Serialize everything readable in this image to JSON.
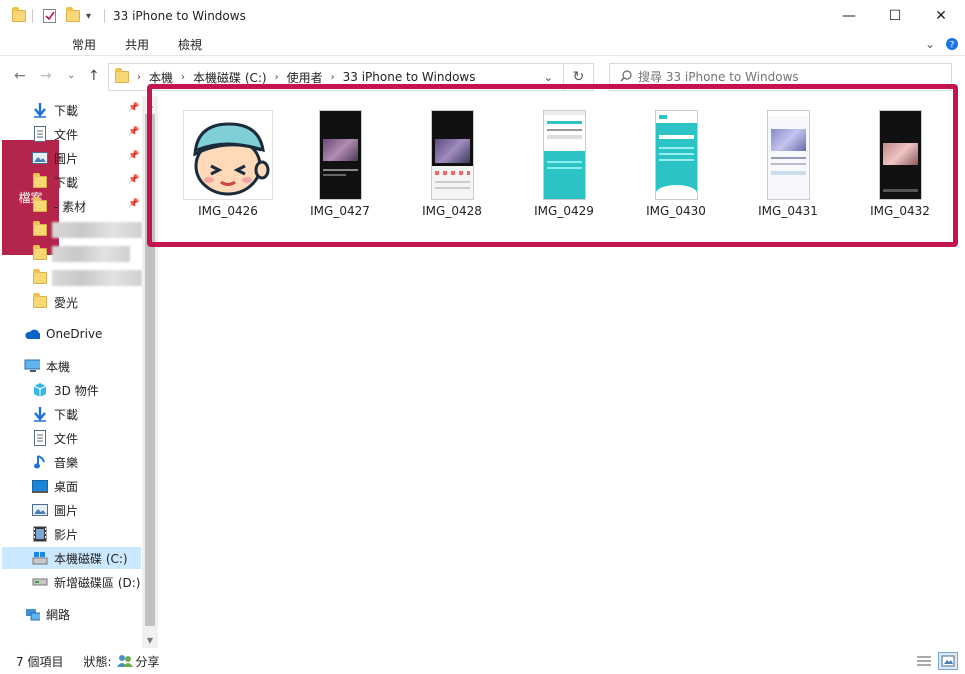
{
  "window": {
    "title": "33 iPhone to Windows",
    "minimize_glyph": "—",
    "maximize_glyph": "☐",
    "close_glyph": "✕"
  },
  "ribbon": {
    "tabs": [
      "檔案",
      "常用",
      "共用",
      "檢視"
    ],
    "collapse_glyph": "⌄",
    "help_glyph": "?"
  },
  "address": {
    "back_glyph": "←",
    "forward_glyph": "→",
    "recent_glyph": "⌄",
    "up_glyph": "↑",
    "breadcrumbs": [
      "本機",
      "本機磁碟 (C:)",
      "使用者",
      "33 iPhone to Windows"
    ],
    "separator": "›",
    "dropdown_glyph": "⌄",
    "refresh_glyph": "↻",
    "search_placeholder": "搜尋 33 iPhone to Windows"
  },
  "nav": {
    "quick_access": [
      {
        "label": "下載",
        "icon": "download-icon",
        "pinned": true
      },
      {
        "label": "文件",
        "icon": "document-icon",
        "pinned": true
      },
      {
        "label": "圖片",
        "icon": "pictures-icon",
        "pinned": true
      },
      {
        "label": "下載",
        "icon": "folder-icon",
        "pinned": true
      },
      {
        "label": "- 素材",
        "icon": "folder-icon",
        "pinned": true
      },
      {
        "label": "",
        "icon": "folder-icon",
        "pinned": false
      },
      {
        "label": "",
        "icon": "folder-icon",
        "pinned": false
      },
      {
        "label": "",
        "icon": "folder-icon",
        "pinned": false
      },
      {
        "label": "愛光",
        "icon": "folder-icon",
        "pinned": false
      }
    ],
    "pin_glyph": "📌",
    "onedrive": "OneDrive",
    "this_pc": "本機",
    "pc_items": [
      {
        "label": "3D 物件",
        "icon": "3d-objects-icon"
      },
      {
        "label": "下載",
        "icon": "download-icon"
      },
      {
        "label": "文件",
        "icon": "document-icon"
      },
      {
        "label": "音樂",
        "icon": "music-icon"
      },
      {
        "label": "桌面",
        "icon": "desktop-icon"
      },
      {
        "label": "圖片",
        "icon": "pictures-icon"
      },
      {
        "label": "影片",
        "icon": "videos-icon"
      },
      {
        "label": "本機磁碟 (C:)",
        "icon": "drive-c-icon",
        "selected": true
      },
      {
        "label": "新增磁碟區 (D:)",
        "icon": "drive-d-icon"
      }
    ],
    "network": "網路"
  },
  "files": [
    {
      "name": "IMG_0426",
      "kind": "avatar"
    },
    {
      "name": "IMG_0427",
      "kind": "dark-video"
    },
    {
      "name": "IMG_0428",
      "kind": "share-sheet"
    },
    {
      "name": "IMG_0429",
      "kind": "teal-page"
    },
    {
      "name": "IMG_0430",
      "kind": "teal-wave"
    },
    {
      "name": "IMG_0431",
      "kind": "light-page"
    },
    {
      "name": "IMG_0432",
      "kind": "dark-player"
    }
  ],
  "status": {
    "count": "7 個項目",
    "state_label": "狀態:",
    "shared": "分享"
  },
  "colors": {
    "file_tab": "#b5254b",
    "highlight": "#c3144f",
    "selected": "#cce8ff",
    "teal": "#2bc3c3"
  }
}
